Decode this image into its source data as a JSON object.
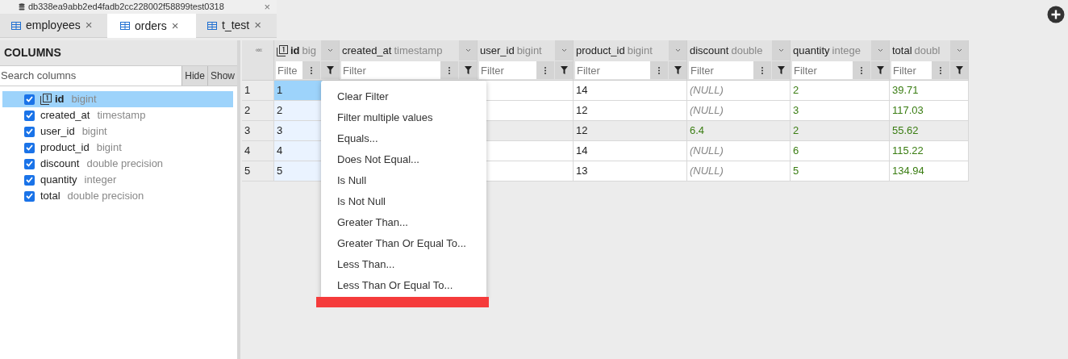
{
  "database_tab": {
    "label": "db338ea9abb2ed4fadb2cc228002f58899test0318",
    "close": "×"
  },
  "tabs": [
    {
      "label": "employees",
      "close": "×",
      "selected": false
    },
    {
      "label": "orders",
      "close": "×",
      "selected": true
    },
    {
      "label": "t_test",
      "close": "×",
      "selected": false
    }
  ],
  "columns_panel": {
    "title": "COLUMNS",
    "search": {
      "placeholder": "Search columns"
    },
    "buttons": [
      "Hide",
      "Show"
    ],
    "items": [
      {
        "name": "id",
        "type": "bigint",
        "checked": true,
        "selected": true,
        "primary_key": true
      },
      {
        "name": "created_at",
        "type": "timestamp",
        "checked": true,
        "selected": false,
        "primary_key": false
      },
      {
        "name": "user_id",
        "type": "bigint",
        "checked": true,
        "selected": false,
        "primary_key": false
      },
      {
        "name": "product_id",
        "type": "bigint",
        "checked": true,
        "selected": false,
        "primary_key": false
      },
      {
        "name": "discount",
        "type": "double precision",
        "checked": true,
        "selected": false,
        "primary_key": false
      },
      {
        "name": "quantity",
        "type": "integer",
        "checked": true,
        "selected": false,
        "primary_key": false
      },
      {
        "name": "total",
        "type": "double precision",
        "checked": true,
        "selected": false,
        "primary_key": false
      }
    ]
  },
  "grid": {
    "collapse": "«««",
    "columns": [
      {
        "name": "id",
        "type": "big",
        "primary_key": true,
        "filter_placeholder": "Filte"
      },
      {
        "name": "created_at",
        "type": "timestamp",
        "primary_key": false,
        "filter_placeholder": "Filter"
      },
      {
        "name": "user_id",
        "type": "bigint",
        "primary_key": false,
        "filter_placeholder": "Filter"
      },
      {
        "name": "product_id",
        "type": "bigint",
        "primary_key": false,
        "filter_placeholder": "Filter"
      },
      {
        "name": "discount",
        "type": "double",
        "primary_key": false,
        "filter_placeholder": "Filter"
      },
      {
        "name": "quantity",
        "type": "intege",
        "primary_key": false,
        "filter_placeholder": "Filter"
      },
      {
        "name": "total",
        "type": "doubl",
        "primary_key": false,
        "filter_placeholder": "Filter"
      }
    ],
    "rows": [
      {
        "number": "1",
        "highlighted": false,
        "cells": [
          {
            "text": "1",
            "kind": "plain",
            "selected": true
          },
          {
            "text": ""
          },
          {
            "text": ""
          },
          {
            "text": "14",
            "kind": "plain"
          },
          {
            "text": "(NULL)",
            "kind": "null"
          },
          {
            "text": "2",
            "kind": "number"
          },
          {
            "text": "39.71",
            "kind": "number"
          }
        ]
      },
      {
        "number": "2",
        "highlighted": false,
        "cells": [
          {
            "text": "2",
            "kind": "plain",
            "selected": false
          },
          {
            "text": ""
          },
          {
            "text": ""
          },
          {
            "text": "12",
            "kind": "plain"
          },
          {
            "text": "(NULL)",
            "kind": "null"
          },
          {
            "text": "3",
            "kind": "number"
          },
          {
            "text": "117.03",
            "kind": "number"
          }
        ]
      },
      {
        "number": "3",
        "highlighted": true,
        "cells": [
          {
            "text": "3",
            "kind": "plain",
            "selected": false
          },
          {
            "text": ""
          },
          {
            "text": ""
          },
          {
            "text": "12",
            "kind": "plain"
          },
          {
            "text": "6.4",
            "kind": "number"
          },
          {
            "text": "2",
            "kind": "number"
          },
          {
            "text": "55.62",
            "kind": "number"
          }
        ]
      },
      {
        "number": "4",
        "highlighted": false,
        "cells": [
          {
            "text": "4",
            "kind": "plain",
            "selected": false
          },
          {
            "text": ""
          },
          {
            "text": ""
          },
          {
            "text": "14",
            "kind": "plain"
          },
          {
            "text": "(NULL)",
            "kind": "null"
          },
          {
            "text": "6",
            "kind": "number"
          },
          {
            "text": "115.22",
            "kind": "number"
          }
        ]
      },
      {
        "number": "5",
        "highlighted": false,
        "cells": [
          {
            "text": "5",
            "kind": "plain",
            "selected": false
          },
          {
            "text": ""
          },
          {
            "text": ""
          },
          {
            "text": "13",
            "kind": "plain"
          },
          {
            "text": "(NULL)",
            "kind": "null"
          },
          {
            "text": "5",
            "kind": "number"
          },
          {
            "text": "134.94",
            "kind": "number"
          }
        ]
      }
    ]
  },
  "filter_menu": {
    "items": [
      "Clear Filter",
      "Filter multiple values",
      "Equals...",
      "Does Not Equal...",
      "Is Null",
      "Is Not Null",
      "Greater Than...",
      "Greater Than Or Equal To...",
      "Less Than...",
      "Less Than Or Equal To..."
    ]
  }
}
